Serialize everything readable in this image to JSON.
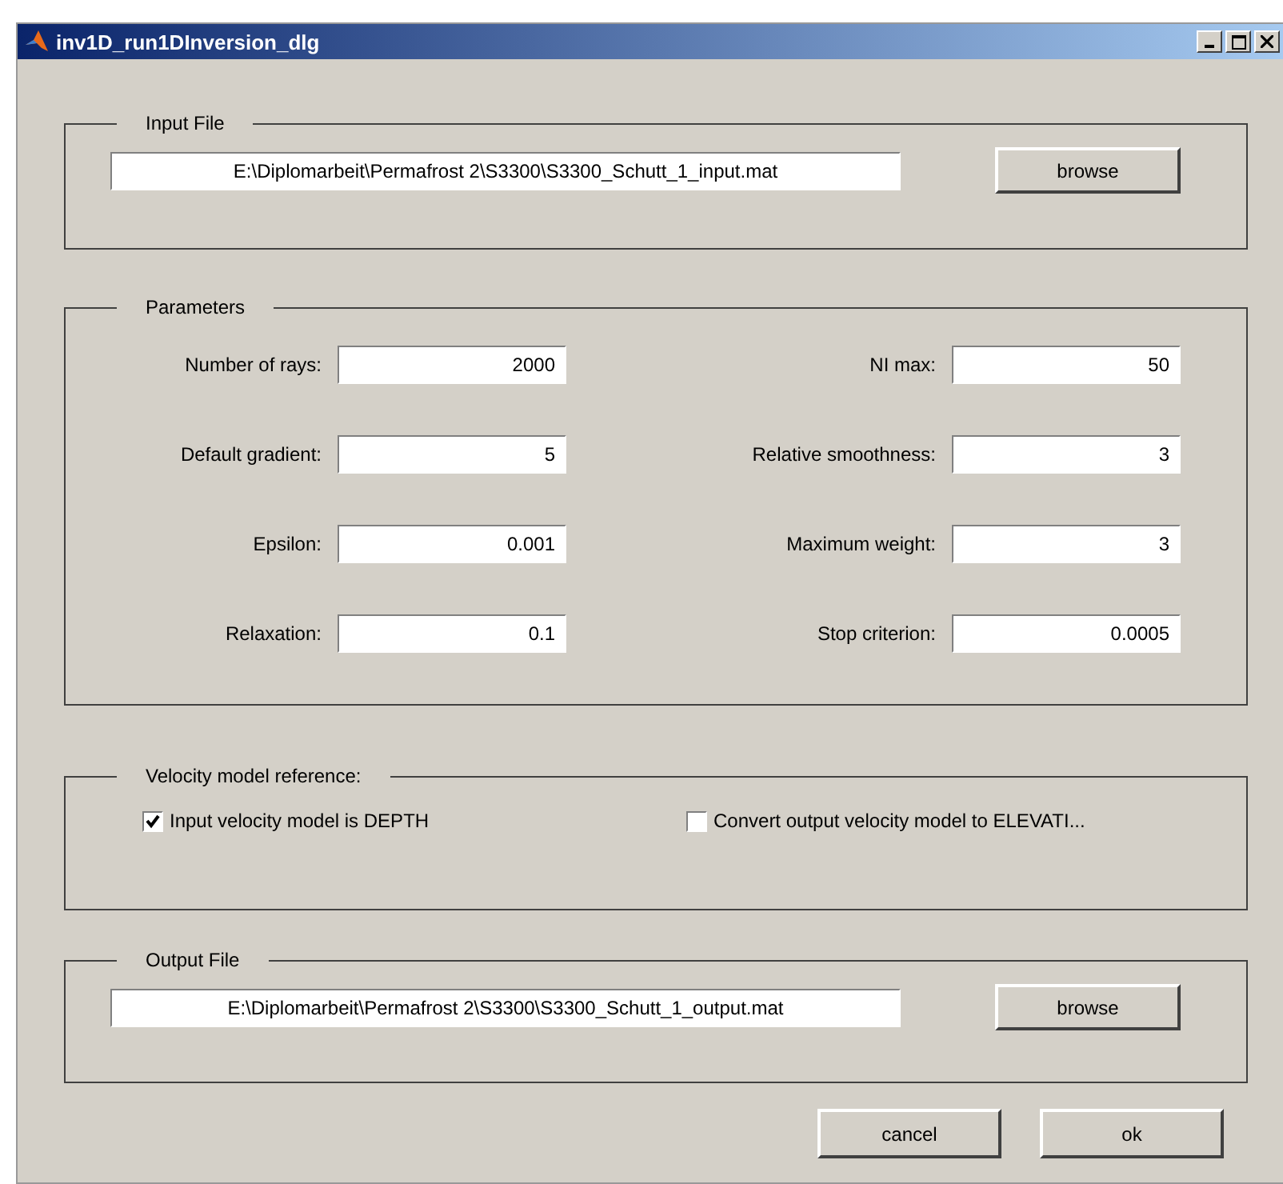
{
  "window": {
    "title": "inv1D_run1DInversion_dlg"
  },
  "input_file": {
    "title": "Input File",
    "value": "E:\\Diplomarbeit\\Permafrost 2\\S3300\\S3300_Schutt_1_input.mat",
    "button": "browse"
  },
  "parameters": {
    "title": "Parameters",
    "rows": [
      {
        "left": {
          "label": "Number of rays:",
          "value": "2000"
        },
        "right": {
          "label": "NI max:",
          "value": "50"
        }
      },
      {
        "left": {
          "label": "Default gradient:",
          "value": "5"
        },
        "right": {
          "label": "Relative smoothness:",
          "value": "3"
        }
      },
      {
        "left": {
          "label": "Epsilon:",
          "value": "0.001"
        },
        "right": {
          "label": "Maximum weight:",
          "value": "3"
        }
      },
      {
        "left": {
          "label": "Relaxation:",
          "value": "0.1"
        },
        "right": {
          "label": "Stop criterion:",
          "value": "0.0005"
        }
      }
    ]
  },
  "velocity_reference": {
    "title": "Velocity model reference:",
    "options": [
      {
        "label": "Input velocity model is DEPTH",
        "checked": true
      },
      {
        "label": "Convert output velocity model to ELEVATI...",
        "checked": false
      }
    ]
  },
  "output_file": {
    "title": "Output File",
    "value": "E:\\Diplomarbeit\\Permafrost 2\\S3300\\S3300_Schutt_1_output.mat",
    "button": "browse"
  },
  "buttons": [
    "cancel",
    "ok"
  ]
}
